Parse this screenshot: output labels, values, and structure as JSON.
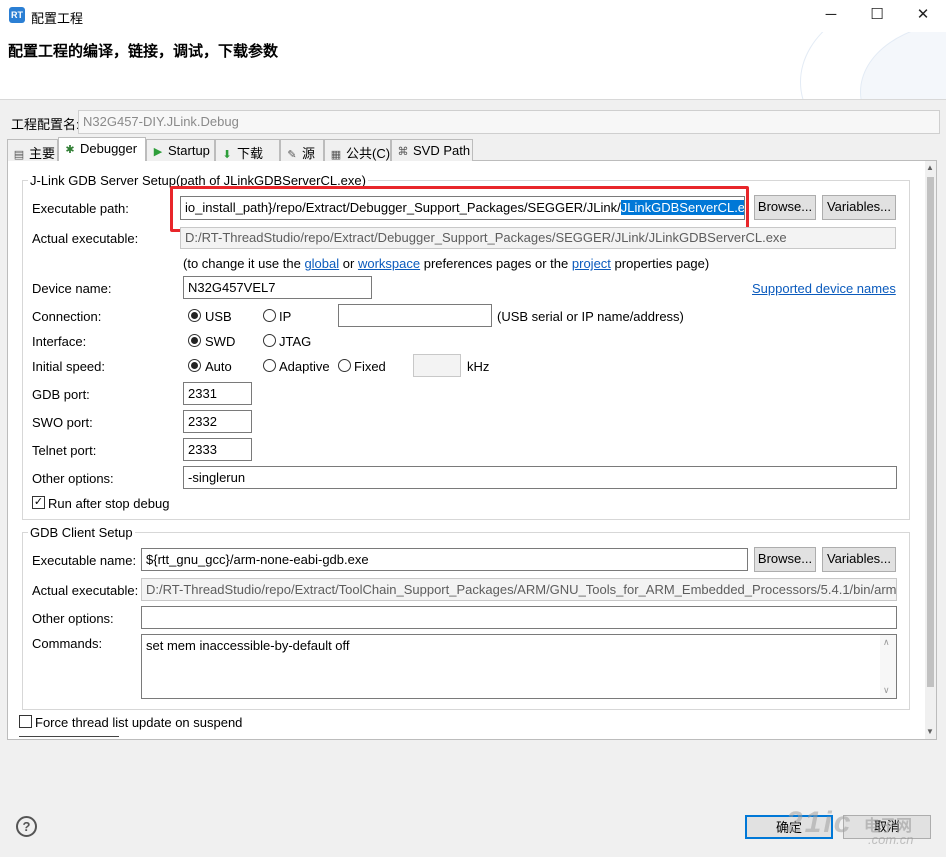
{
  "window": {
    "title": "配置工程",
    "minimize": "─",
    "maximize": "☐",
    "close": "✕",
    "icon": "rt-logo-icon"
  },
  "banner": {
    "title": "配置工程的编译，链接，调试，下载参数"
  },
  "config": {
    "label": "工程配置名:",
    "value": "N32G457-DIY.JLink.Debug"
  },
  "tabs": [
    {
      "label": "主要",
      "icon": "▤"
    },
    {
      "label": "Debugger",
      "icon": "✱"
    },
    {
      "label": "Startup",
      "icon": "▶"
    },
    {
      "label": "下载",
      "icon": "⬇"
    },
    {
      "label": "源",
      "icon": "✎"
    },
    {
      "label": "公共(C)",
      "icon": "▦"
    },
    {
      "label": "SVD Path",
      "icon": "⌘"
    }
  ],
  "jlink": {
    "group_title": "J-Link GDB Server Setup(path of JLinkGDBServerCL.exe)",
    "exe_label": "Executable path:",
    "exe_value_prefix": "io_install_path}/repo/Extract/Debugger_Support_Packages/SEGGER/JLink/",
    "exe_value_selected": "JLinkGDBServerCL.exe",
    "browse": "Browse...",
    "variables": "Variables...",
    "actual_label": "Actual executable:",
    "actual_value": "D:/RT-ThreadStudio/repo/Extract/Debugger_Support_Packages/SEGGER/JLink/JLinkGDBServerCL.exe",
    "hint_1": "(to change it use the",
    "hint_global": "global",
    "hint_or": "or",
    "hint_workspace": "workspace",
    "hint_2": "preferences pages or the",
    "hint_project": "project",
    "hint_3": "properties page)",
    "device_label": "Device name:",
    "device_value": "N32G457VEL7",
    "supported_link": "Supported device names",
    "connection_label": "Connection:",
    "conn_usb": "USB",
    "conn_ip": "IP",
    "conn_hint": "(USB serial or IP name/address)",
    "interface_label": "Interface:",
    "if_swd": "SWD",
    "if_jtag": "JTAG",
    "speed_label": "Initial speed:",
    "speed_auto": "Auto",
    "speed_adaptive": "Adaptive",
    "speed_fixed": "Fixed",
    "speed_unit": "kHz",
    "gdb_port_label": "GDB port:",
    "gdb_port": "2331",
    "swo_port_label": "SWO port:",
    "swo_port": "2332",
    "telnet_port_label": "Telnet port:",
    "telnet_port": "2333",
    "other_label": "Other options:",
    "other_value": "-singlerun",
    "run_after_stop": "Run after stop debug"
  },
  "gdb_client": {
    "group_title": "GDB Client Setup",
    "exe_label": "Executable name:",
    "exe_value": "${rtt_gnu_gcc}/arm-none-eabi-gdb.exe",
    "browse": "Browse...",
    "variables": "Variables...",
    "actual_label": "Actual executable:",
    "actual_value": "D:/RT-ThreadStudio/repo/Extract/ToolChain_Support_Packages/ARM/GNU_Tools_for_ARM_Embedded_Processors/5.4.1/bin/arm-",
    "other_label": "Other options:",
    "other_value": "",
    "commands_label": "Commands:",
    "commands_value": "set mem inaccessible-by-default off"
  },
  "force_thread": "Force thread list update on suspend",
  "footer": {
    "help": "?",
    "ok": "确定",
    "cancel": "取消"
  },
  "watermark": {
    "main": "21ic",
    "cn": "电子网",
    "url": ".com.cn"
  }
}
